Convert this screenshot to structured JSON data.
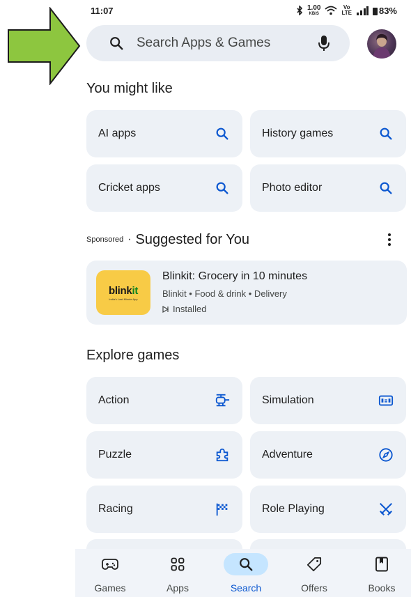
{
  "status_bar": {
    "time": "11:07",
    "speed_value": "1.00",
    "speed_unit": "KB/S",
    "volte_top": "Vo",
    "volte_bottom": "LTE",
    "battery": "83%"
  },
  "search": {
    "placeholder": "Search Apps & Games"
  },
  "you_might_like": {
    "title": "You might like",
    "chips": [
      {
        "label": "AI apps",
        "icon": "search-icon"
      },
      {
        "label": "History games",
        "icon": "search-icon"
      },
      {
        "label": "Cricket apps",
        "icon": "search-icon"
      },
      {
        "label": "Photo editor",
        "icon": "search-icon"
      }
    ]
  },
  "suggested": {
    "sponsored_tag": "Sponsored",
    "separator": "·",
    "title": "Suggested for You",
    "app": {
      "logo_text": "blinkit",
      "logo_tagline": "India's Last Minute App",
      "name": "Blinkit: Grocery in 10 minutes",
      "meta": "Blinkit • Food & drink • Delivery",
      "status": "Installed"
    }
  },
  "explore_games": {
    "title": "Explore games",
    "categories": [
      {
        "label": "Action",
        "icon": "helicopter-icon"
      },
      {
        "label": "Simulation",
        "icon": "simulation-icon"
      },
      {
        "label": "Puzzle",
        "icon": "puzzle-icon"
      },
      {
        "label": "Adventure",
        "icon": "compass-icon"
      },
      {
        "label": "Racing",
        "icon": "checkered-flag-icon"
      },
      {
        "label": "Role Playing",
        "icon": "swords-icon"
      }
    ]
  },
  "bottom_nav": {
    "items": [
      {
        "label": "Games",
        "icon": "gamepad-icon"
      },
      {
        "label": "Apps",
        "icon": "apps-grid-icon"
      },
      {
        "label": "Search",
        "icon": "search-icon",
        "active": true
      },
      {
        "label": "Offers",
        "icon": "offer-tag-icon"
      },
      {
        "label": "Books",
        "icon": "book-icon"
      }
    ]
  },
  "colors": {
    "accent_blue": "#0b57d0",
    "chip_bg": "#edf1f6",
    "arrow_green": "#8dc63f",
    "nav_active_pill": "#c5e5ff"
  }
}
